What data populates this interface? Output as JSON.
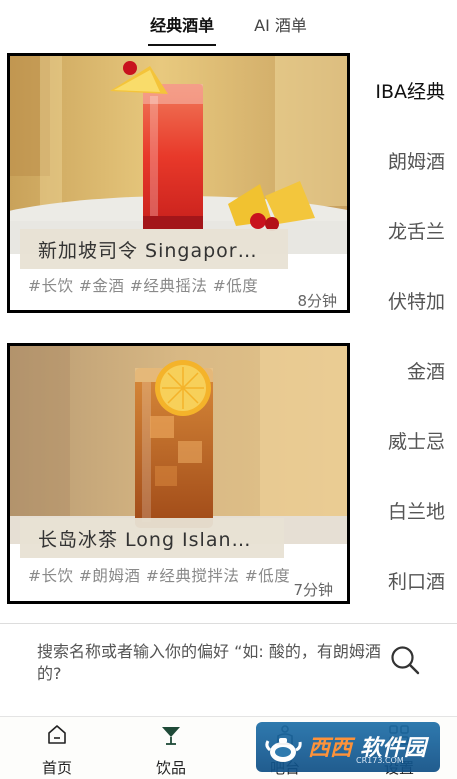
{
  "top_tabs": [
    {
      "label": "经典酒单",
      "active": true
    },
    {
      "label": "AI 酒单",
      "active": false
    }
  ],
  "drinks": [
    {
      "title": "新加坡司令 Singapor…",
      "tags": "#长饮 #金酒 #经典摇法 #低度",
      "time": "8分钟"
    },
    {
      "title": "长岛冰茶 Long Islan…",
      "tags": "#长饮 #朗姆酒 #经典搅拌法 #低度",
      "time": "7分钟"
    }
  ],
  "categories": [
    {
      "label": "IBA经典",
      "active": true
    },
    {
      "label": "朗姆酒",
      "active": false
    },
    {
      "label": "龙舌兰",
      "active": false
    },
    {
      "label": "伏特加",
      "active": false
    },
    {
      "label": "金酒",
      "active": false
    },
    {
      "label": "威士忌",
      "active": false
    },
    {
      "label": "白兰地",
      "active": false
    },
    {
      "label": "利口酒",
      "active": false
    }
  ],
  "search": {
    "placeholder": "搜索名称或者输入你的偏好 “如: 酸的，有朗姆酒的?"
  },
  "bottom_nav": [
    {
      "label": "首页",
      "icon": "home-icon"
    },
    {
      "label": "饮品",
      "icon": "cocktail-glass-icon",
      "active": true
    },
    {
      "label": "吧台",
      "icon": "bar-icon"
    },
    {
      "label": "设置",
      "icon": "grid-settings-icon"
    }
  ],
  "watermark": {
    "brand_orange": "西西",
    "brand_white": "软件园",
    "url": "CR173.COM"
  },
  "colors": {
    "card_border": "#000000",
    "title_box": "#e8e2d4",
    "tag_text": "#8a8a8a",
    "watermark_blue": "#1e6fa8",
    "watermark_orange": "#ff8a2a"
  }
}
